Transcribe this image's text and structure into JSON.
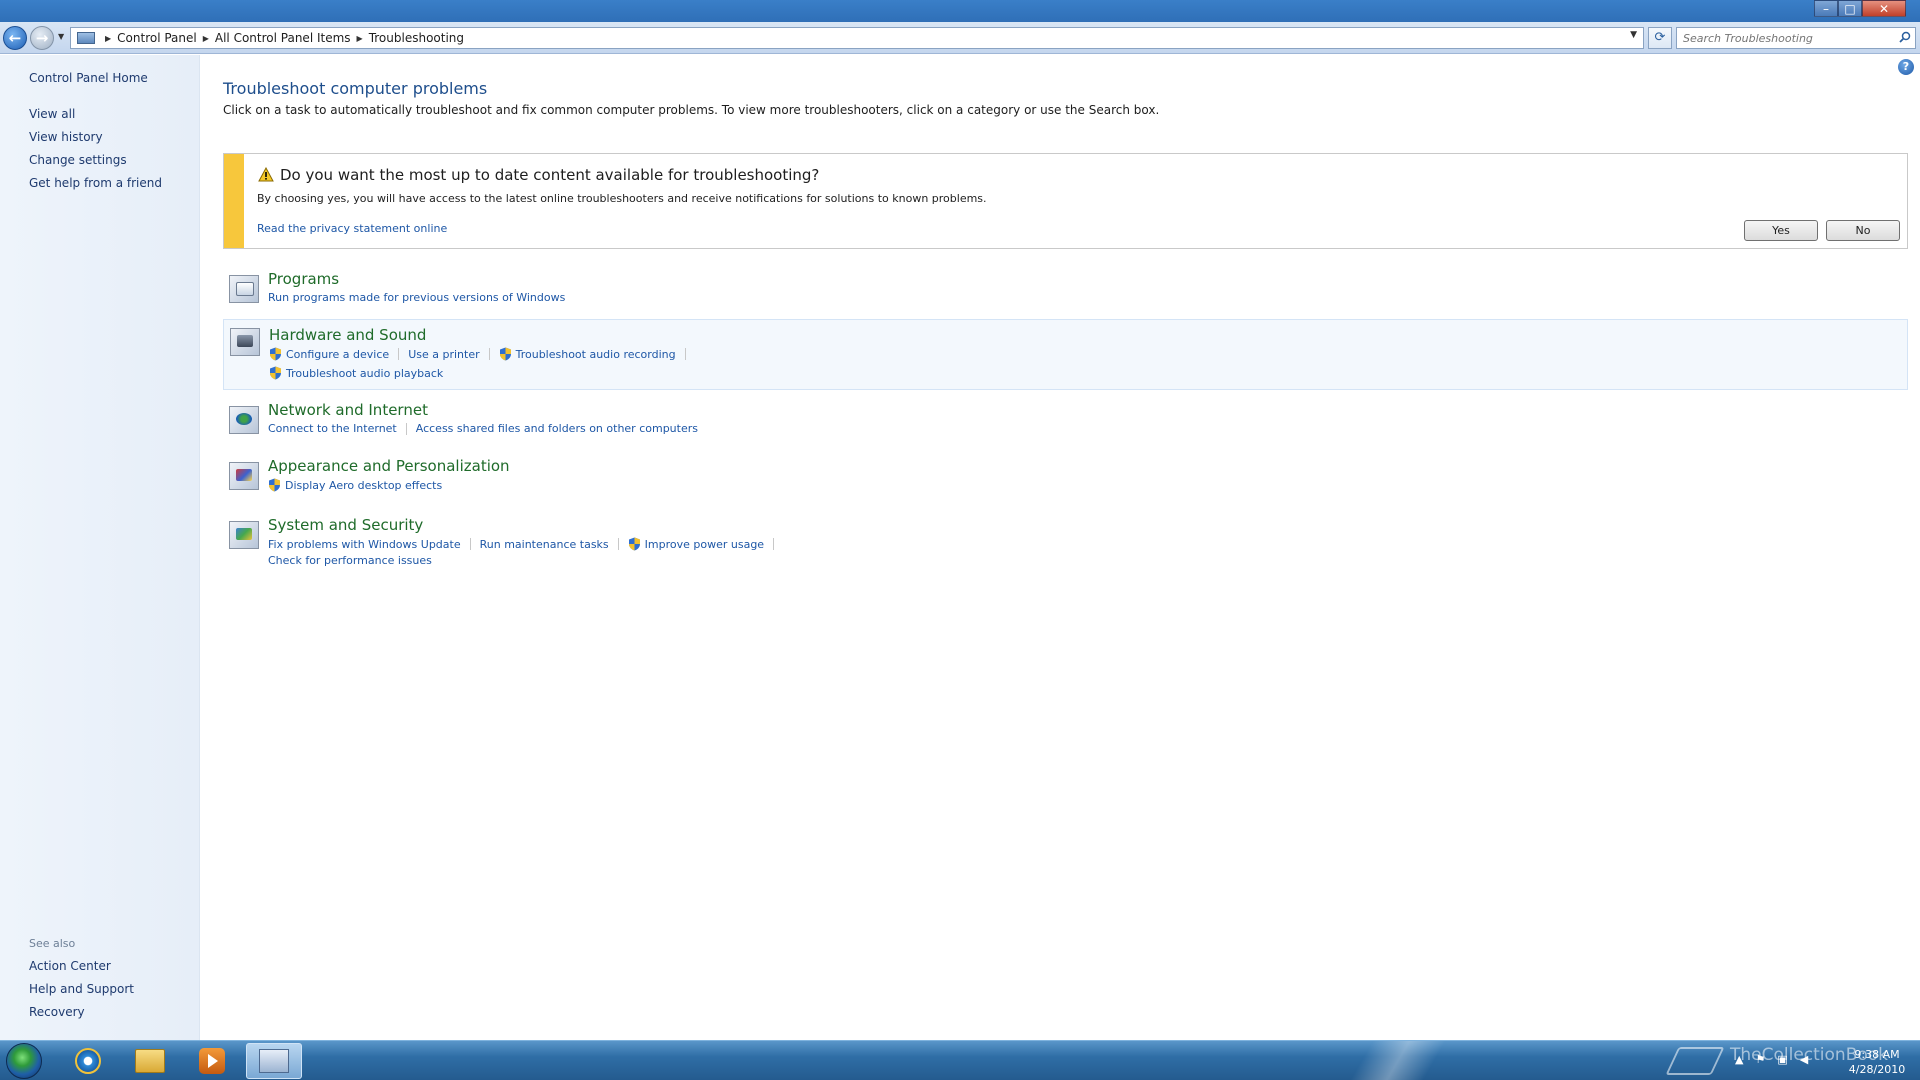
{
  "window": {
    "controls": {
      "minimize": "–",
      "maximize": "□",
      "close": "✕"
    }
  },
  "address": {
    "crumbs": [
      "Control Panel",
      "All Control Panel Items",
      "Troubleshooting"
    ],
    "search_placeholder": "Search Troubleshooting"
  },
  "sidebar": {
    "home": "Control Panel Home",
    "links": [
      "View all",
      "View history",
      "Change settings",
      "Get help from a friend"
    ],
    "see_also_label": "See also",
    "see_also": [
      "Action Center",
      "Help and Support",
      "Recovery"
    ]
  },
  "main": {
    "title": "Troubleshoot computer problems",
    "description": "Click on a task to automatically troubleshoot and fix common computer problems. To view more troubleshooters, click on a category or use the Search box.",
    "infobar": {
      "question": "Do you want the most up to date content available for troubleshooting?",
      "detail": "By choosing yes, you will have access to the latest online troubleshooters and receive notifications for solutions to known problems.",
      "privacy_link": "Read the privacy statement online",
      "yes": "Yes",
      "no": "No"
    },
    "categories": [
      {
        "title": "Programs",
        "icon": "programs-icon",
        "links": [
          {
            "label": "Run programs made for previous versions of Windows",
            "shield": false
          }
        ]
      },
      {
        "title": "Hardware and Sound",
        "icon": "hardware-sound-icon",
        "links": [
          {
            "label": "Configure a device",
            "shield": true
          },
          {
            "label": "Use a printer",
            "shield": false
          },
          {
            "label": "Troubleshoot audio recording",
            "shield": true
          },
          {
            "label": "Troubleshoot audio playback",
            "shield": true
          }
        ]
      },
      {
        "title": "Network and Internet",
        "icon": "network-internet-icon",
        "links": [
          {
            "label": "Connect to the Internet",
            "shield": false
          },
          {
            "label": "Access shared files and folders on other computers",
            "shield": false
          }
        ]
      },
      {
        "title": "Appearance and Personalization",
        "icon": "appearance-icon",
        "links": [
          {
            "label": "Display Aero desktop effects",
            "shield": true
          }
        ]
      },
      {
        "title": "System and Security",
        "icon": "system-security-icon",
        "links": [
          {
            "label": "Fix problems with Windows Update",
            "shield": false
          },
          {
            "label": "Run maintenance tasks",
            "shield": false
          },
          {
            "label": "Improve power usage",
            "shield": true
          },
          {
            "label": "Check for performance issues",
            "shield": false
          }
        ]
      }
    ]
  },
  "taskbar": {
    "time": "9:38 AM",
    "date": "4/28/2010",
    "watermark": "TheCollectionBook"
  }
}
